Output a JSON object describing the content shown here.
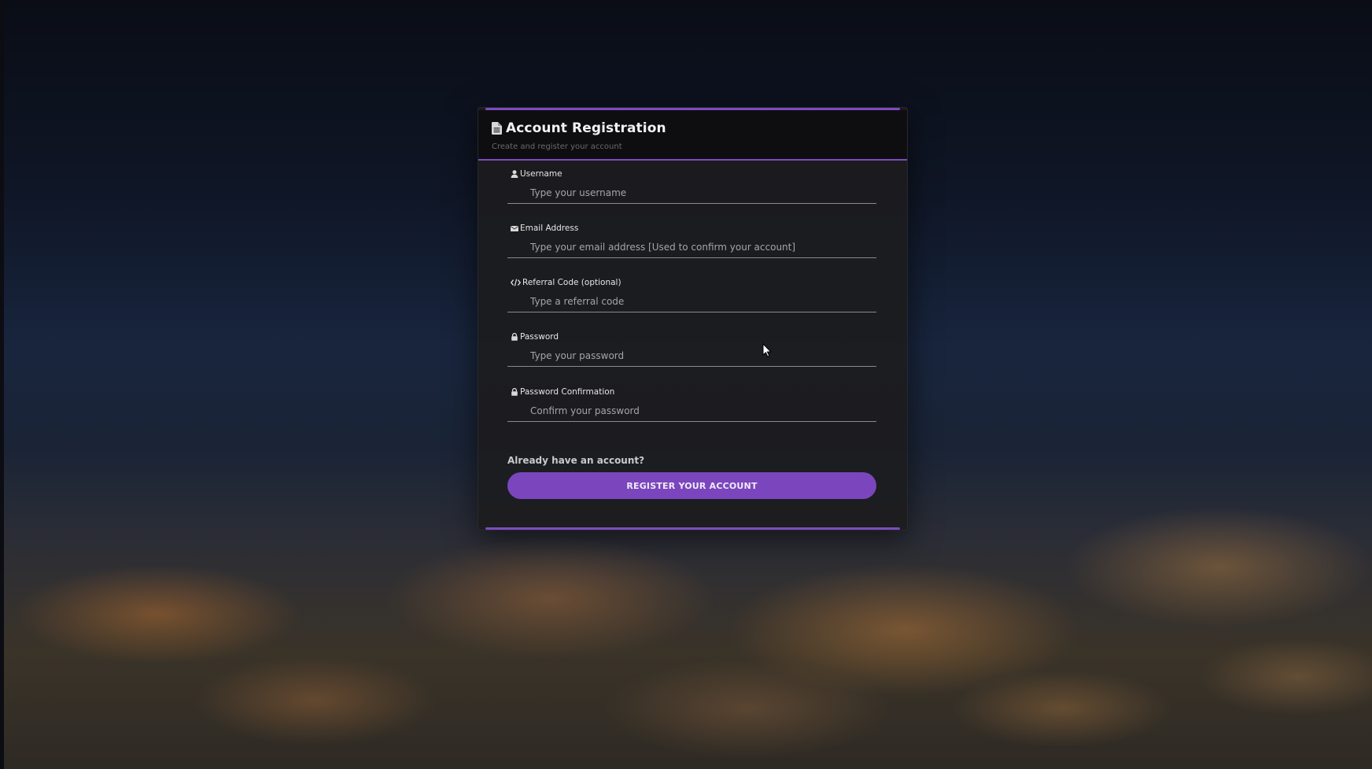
{
  "header": {
    "title": "Account Registration",
    "subtitle": "Create and register your account"
  },
  "fields": [
    {
      "label": "Username",
      "placeholder": "Type your username",
      "value": "",
      "icon": "user-icon"
    },
    {
      "label": "Email Address",
      "placeholder": "Type your email address [Used to confirm your account]",
      "value": "",
      "icon": "envelope-icon"
    },
    {
      "label": "Referral Code (optional)",
      "placeholder": "Type a referral code",
      "value": "",
      "icon": "code-icon"
    },
    {
      "label": "Password",
      "placeholder": "Type your password",
      "value": "",
      "icon": "lock-icon"
    },
    {
      "label": "Password Confirmation",
      "placeholder": "Confirm your password",
      "value": "",
      "icon": "lock-icon"
    }
  ],
  "login_link": "Already have an account?",
  "submit_label": "REGISTER YOUR ACCOUNT",
  "colors": {
    "accent": "#7d4bc0",
    "button": "#7b46bd",
    "card_bg": "#1c1c1e"
  }
}
